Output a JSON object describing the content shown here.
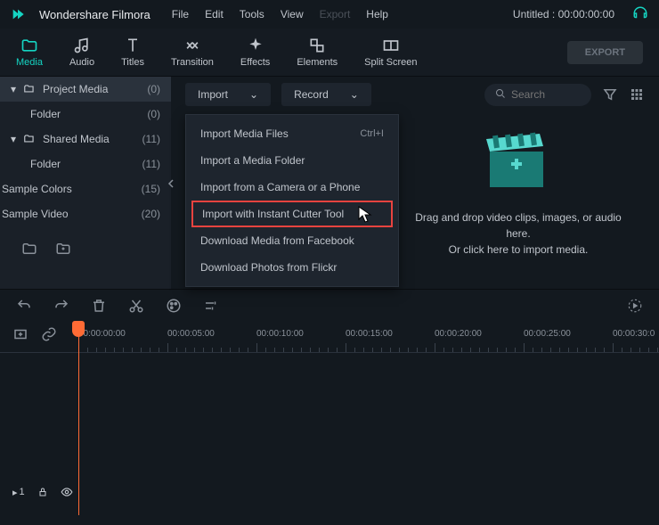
{
  "app": {
    "name": "Wondershare Filmora"
  },
  "menu": [
    "File",
    "Edit",
    "Tools",
    "View",
    "Export",
    "Help"
  ],
  "menu_disabled_index": 4,
  "project_title": "Untitled : 00:00:00:00",
  "toolbar": {
    "items": [
      {
        "label": "Media",
        "icon": "folder"
      },
      {
        "label": "Audio",
        "icon": "music"
      },
      {
        "label": "Titles",
        "icon": "text"
      },
      {
        "label": "Transition",
        "icon": "transition"
      },
      {
        "label": "Effects",
        "icon": "sparkle"
      },
      {
        "label": "Elements",
        "icon": "shapes"
      },
      {
        "label": "Split Screen",
        "icon": "split"
      }
    ],
    "active_index": 0,
    "export_label": "EXPORT"
  },
  "sidebar": {
    "items": [
      {
        "label": "Project Media",
        "count": "(0)",
        "kind": "folder-open",
        "level": 0,
        "expanded": true,
        "selected": true
      },
      {
        "label": "Folder",
        "count": "(0)",
        "kind": "none",
        "level": 1
      },
      {
        "label": "Shared Media",
        "count": "(11)",
        "kind": "folder-open",
        "level": 0,
        "expanded": true
      },
      {
        "label": "Folder",
        "count": "(11)",
        "kind": "none",
        "level": 1
      },
      {
        "label": "Sample Colors",
        "count": "(15)",
        "kind": "none",
        "level": -1
      },
      {
        "label": "Sample Video",
        "count": "(20)",
        "kind": "none",
        "level": -1
      }
    ]
  },
  "content_toolbar": {
    "import_label": "Import",
    "record_label": "Record",
    "search_placeholder": "Search"
  },
  "import_menu": [
    {
      "label": "Import Media Files",
      "shortcut": "Ctrl+I"
    },
    {
      "label": "Import a Media Folder"
    },
    {
      "label": "Import from a Camera or a Phone"
    },
    {
      "label": "Import with Instant Cutter Tool",
      "highlighted": true
    },
    {
      "label": "Download Media from Facebook"
    },
    {
      "label": "Download Photos from Flickr"
    }
  ],
  "drop": {
    "line1": "Drag and drop video clips, images, or audio here.",
    "line2": "Or click here to import media."
  },
  "timeline": {
    "stamps": [
      "00:00:00:00",
      "00:00:05:00",
      "00:00:10:00",
      "00:00:15:00",
      "00:00:20:00",
      "00:00:25:00",
      "00:00:30:0"
    ],
    "track_badge": "1"
  }
}
